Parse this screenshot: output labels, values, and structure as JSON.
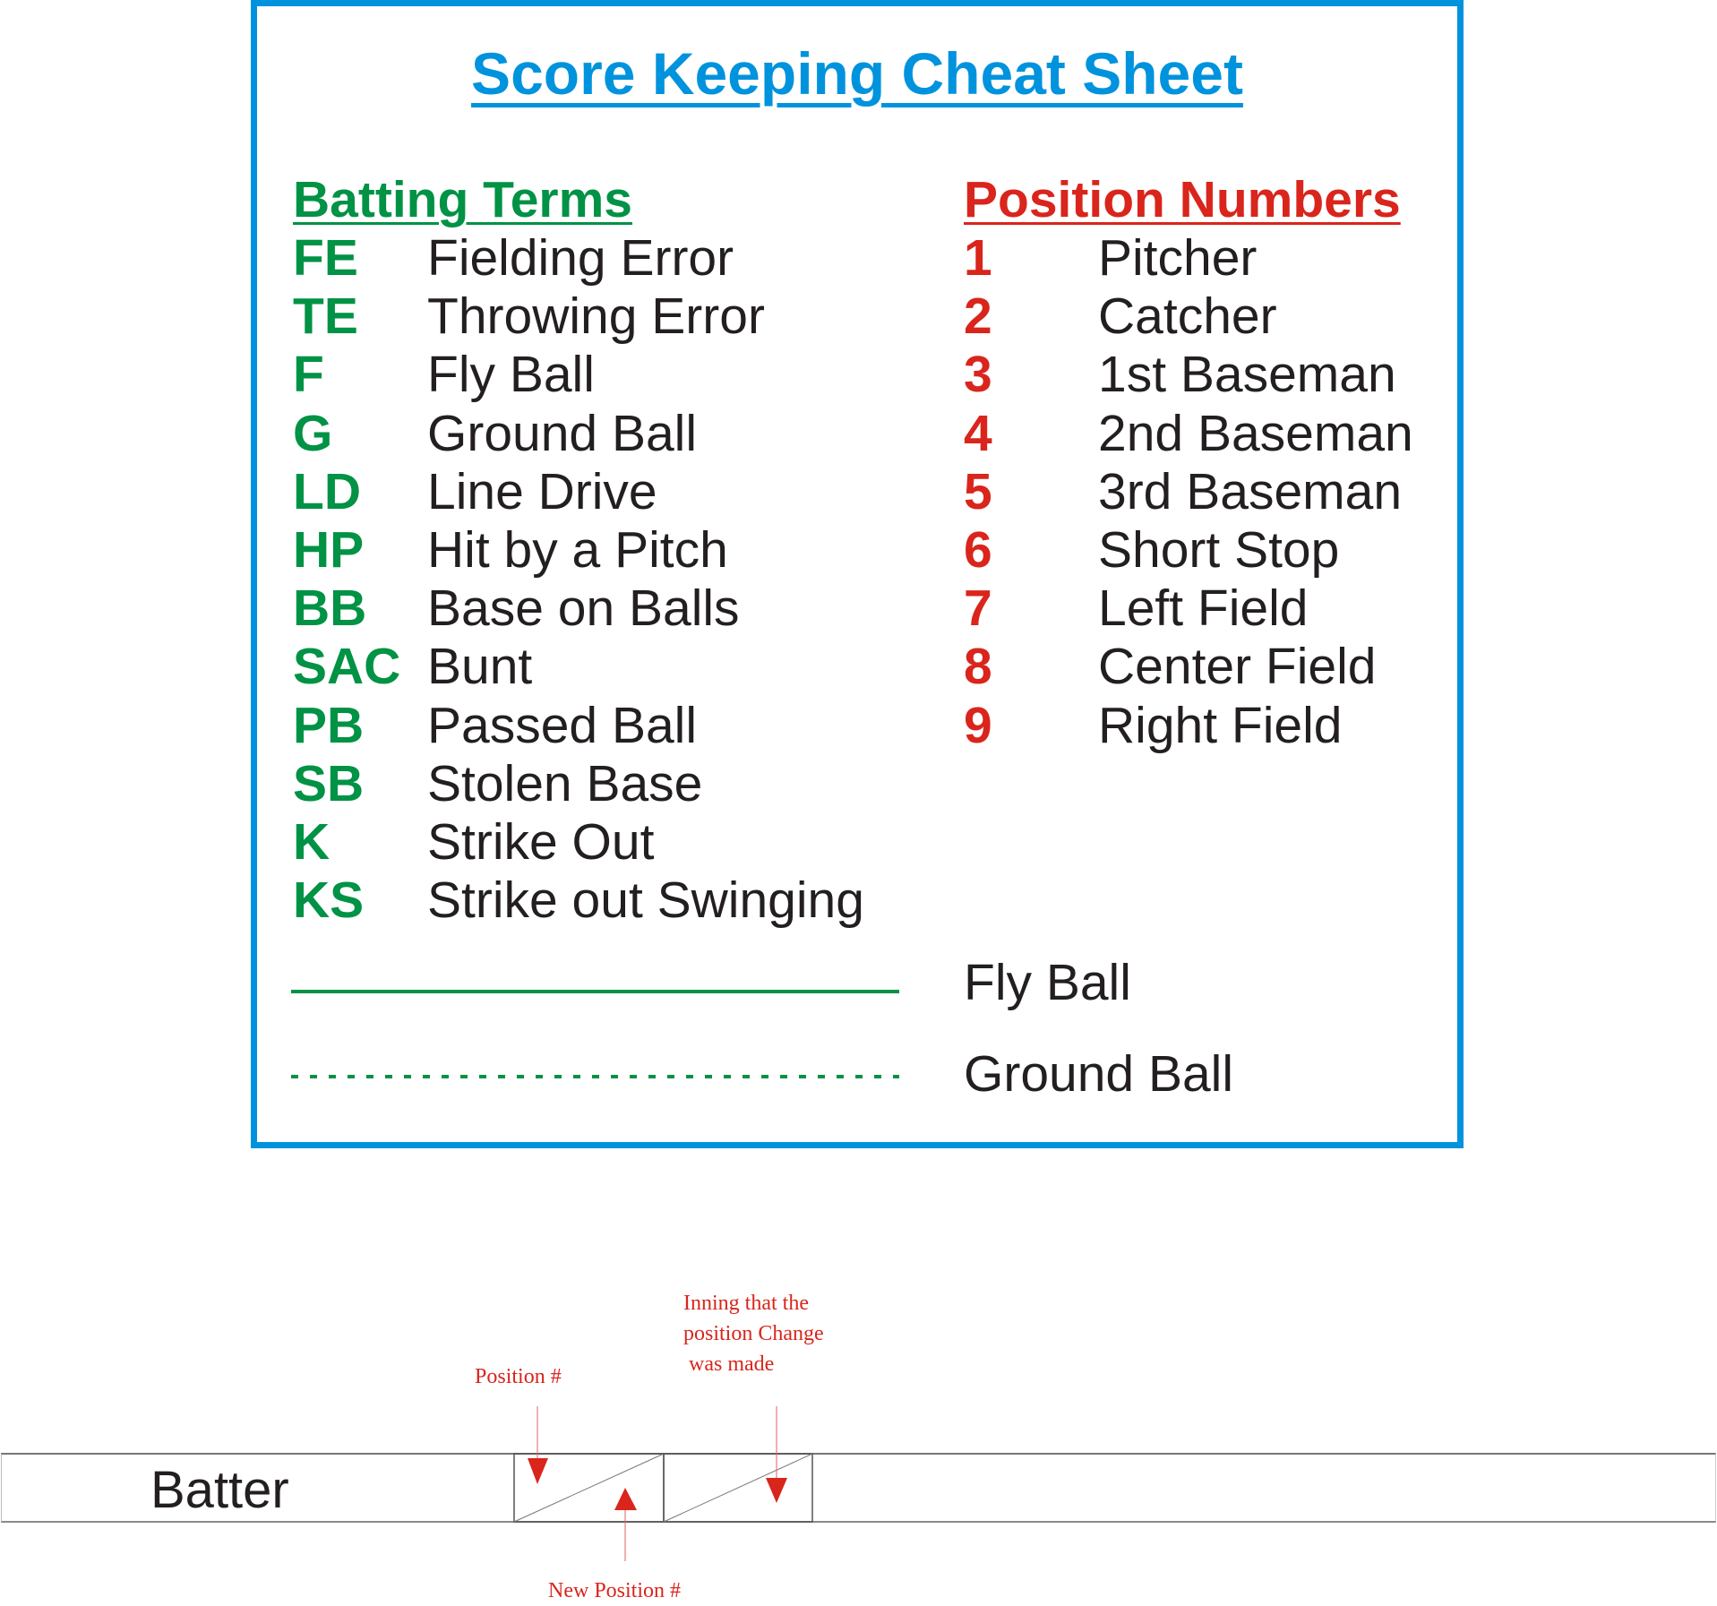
{
  "title": "Score Keeping Cheat Sheet",
  "colors": {
    "border": "#0093dd",
    "title": "#0093dd",
    "batting": "#009245",
    "position": "#d9251c",
    "text": "#231f20",
    "annotation": "#d9251c"
  },
  "batting_terms": {
    "heading": "Batting Terms",
    "items": [
      {
        "code": "FE",
        "label": "Fielding Error"
      },
      {
        "code": "TE",
        "label": "Throwing Error"
      },
      {
        "code": "F",
        "label": "Fly Ball"
      },
      {
        "code": "G",
        "label": "Ground Ball"
      },
      {
        "code": "LD",
        "label": "Line Drive"
      },
      {
        "code": "HP",
        "label": "Hit by a Pitch"
      },
      {
        "code": "BB",
        "label": "Base on Balls"
      },
      {
        "code": "SAC",
        "label": "Bunt"
      },
      {
        "code": "PB",
        "label": "Passed Ball"
      },
      {
        "code": "SB",
        "label": "Stolen Base"
      },
      {
        "code": "K",
        "label": "Strike Out"
      },
      {
        "code": "KS",
        "label": "Strike out Swinging"
      }
    ]
  },
  "position_numbers": {
    "heading": "Position Numbers",
    "items": [
      {
        "code": "1",
        "label": "Pitcher"
      },
      {
        "code": "2",
        "label": "Catcher"
      },
      {
        "code": "3",
        "label": "1st Baseman"
      },
      {
        "code": "4",
        "label": "2nd Baseman"
      },
      {
        "code": "5",
        "label": "3rd Baseman"
      },
      {
        "code": "6",
        "label": "Short Stop"
      },
      {
        "code": "7",
        "label": "Left Field"
      },
      {
        "code": "8",
        "label": "Center Field"
      },
      {
        "code": "9",
        "label": "Right Field"
      }
    ]
  },
  "legend": {
    "fly_ball": {
      "style": "solid",
      "label": "Fly Ball"
    },
    "ground_ball": {
      "style": "dotted",
      "label": "Ground Ball"
    }
  },
  "lineup_example": {
    "batter_label": "Batter",
    "annotations": {
      "position": "Position #",
      "inning": [
        "Inning that the",
        "position Change",
        " was made"
      ],
      "new_position": "New Position #"
    }
  }
}
